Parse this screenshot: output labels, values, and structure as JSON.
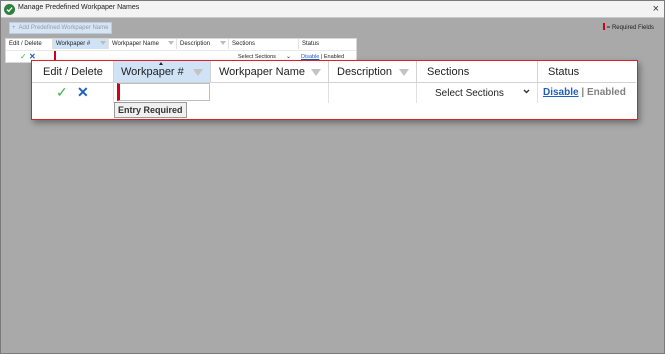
{
  "window": {
    "title": "Manage Predefined Workpaper Names",
    "close_glyph": "×"
  },
  "toolbar": {
    "add_label": "Add Predefined Workpaper Name",
    "required_legend": "= Required Fields"
  },
  "grid": {
    "columns": [
      {
        "label": "Edit / Delete"
      },
      {
        "label": "Workpaper #",
        "selected": true,
        "sorted": "asc"
      },
      {
        "label": "Workpaper Name"
      },
      {
        "label": "Description"
      },
      {
        "label": "Sections"
      },
      {
        "label": "Status"
      }
    ],
    "edit_row": {
      "workpaper_number_value": "",
      "validation_message": "Entry Required",
      "sections_value": "Select Sections",
      "status_link": "Disable",
      "status_separator": " | ",
      "status_state": "Enabled"
    }
  },
  "colors": {
    "accent": "#1f5fbf",
    "required": "#d0021b",
    "selected_header": "#cfe2f6",
    "confirm": "#3bb24a"
  },
  "icons": {
    "app": "shield-check-icon",
    "confirm": "checkmark-icon",
    "cancel": "x-icon",
    "filter": "filter-icon",
    "sort": "sort-ascending-icon",
    "dropdown": "chevron-down-icon"
  }
}
